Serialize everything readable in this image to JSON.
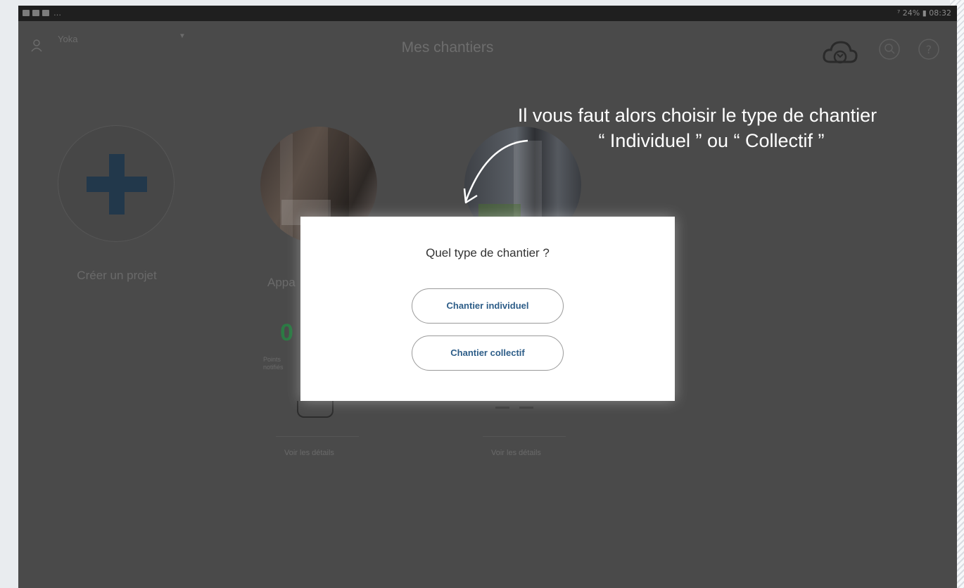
{
  "status_bar": {
    "right_text": "⁷ 24% ▮ 08:32"
  },
  "app_bar": {
    "user_name": "Yoka",
    "title": "Mes chantiers"
  },
  "annotation": {
    "line1": "Il vous faut alors choisir le type de chantier",
    "line2": "“ Individuel ” ou “ Collectif ”"
  },
  "projects": {
    "create_label": "Créer un projet",
    "card1": {
      "name_visible": "Appa",
      "count": "0",
      "count_label": "Points",
      "count_label_2": "notifiés",
      "details": "Voir les détails"
    },
    "card2": {
      "details": "Voir les détails"
    }
  },
  "dialog": {
    "title": "Quel type de chantier ?",
    "option_individuel": "Chantier individuel",
    "option_collectif": "Chantier collectif"
  },
  "colors": {
    "overlay_bg": "#4a4a4a",
    "dialog_bg": "#ffffff",
    "button_text": "#2d5d88",
    "count_green": "#2c7a44",
    "plus_blue": "#22384b"
  },
  "icons": [
    "user-icon",
    "cloud-sync-icon",
    "search-icon",
    "help-icon",
    "plus-icon",
    "curved-arrow-icon"
  ]
}
